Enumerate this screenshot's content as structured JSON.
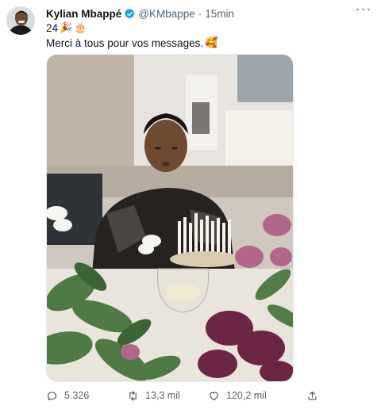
{
  "author": {
    "name": "Kylian Mbappé",
    "handle": "@KMbappe",
    "separator": "·",
    "time": "15min"
  },
  "menu": {
    "more_label": "···"
  },
  "text": {
    "line1": "24",
    "line1_emojis": [
      "🎉",
      "🎂"
    ],
    "line2": "Merci à tous pour vos messages.",
    "line2_emoji": "🥰"
  },
  "icons": {
    "verified": "verified-badge-icon",
    "reply": "reply-icon",
    "retweet": "retweet-icon",
    "like": "heart-icon",
    "share": "share-icon"
  },
  "metrics": {
    "replies": "5.326",
    "retweets": "13,3 mil",
    "likes": "120,2 mil"
  },
  "colors": {
    "verified": "#1d9bf0",
    "text": "#0f1419",
    "secondary": "#536471"
  }
}
